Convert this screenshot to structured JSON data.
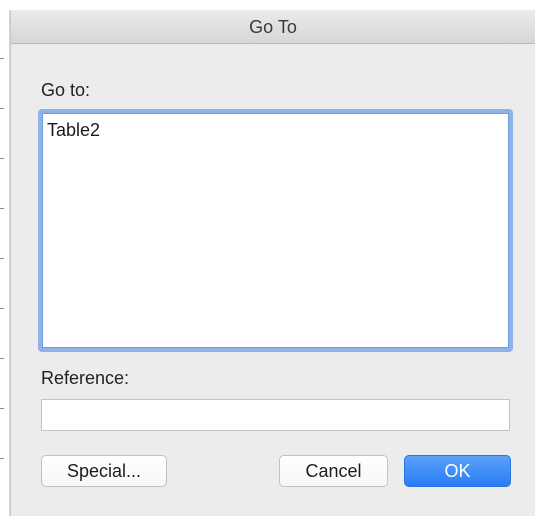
{
  "dialog": {
    "title": "Go To"
  },
  "goto": {
    "label": "Go to:",
    "items": [
      "Table2"
    ]
  },
  "reference": {
    "label": "Reference:",
    "value": "",
    "placeholder": ""
  },
  "buttons": {
    "special": "Special...",
    "cancel": "Cancel",
    "ok": "OK"
  },
  "colors": {
    "focus_ring": "#8fb2e8",
    "default_button": "#2a7cf5",
    "dialog_background": "#ececec"
  }
}
